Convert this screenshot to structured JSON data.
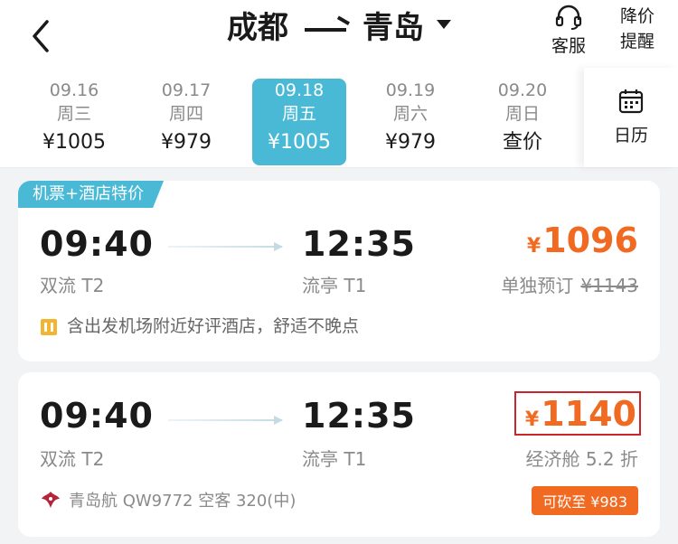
{
  "header": {
    "from": "成都",
    "to": "青岛",
    "customer_service": "客服",
    "price_alert_line1": "降价",
    "price_alert_line2": "提醒"
  },
  "dates": [
    {
      "date": "09.16",
      "weekday": "周三",
      "price": "¥1005"
    },
    {
      "date": "09.17",
      "weekday": "周四",
      "price": "¥979"
    },
    {
      "date": "09.18",
      "weekday": "周五",
      "price": "¥1005"
    },
    {
      "date": "09.19",
      "weekday": "周六",
      "price": "¥979"
    },
    {
      "date": "09.20",
      "weekday": "周日",
      "price": "查价"
    }
  ],
  "calendar": {
    "label": "日历"
  },
  "flights": [
    {
      "badge": "机票+酒店特价",
      "dep_time": "09:40",
      "dep_airport": "双流 T2",
      "arr_time": "12:35",
      "arr_airport": "流亭 T1",
      "currency": "¥",
      "price": "1096",
      "sub_label": "单独预订",
      "original_price": "¥1143",
      "note": "含出发机场附近好评酒店，舒适不晚点"
    },
    {
      "dep_time": "09:40",
      "dep_airport": "双流 T2",
      "arr_time": "12:35",
      "arr_airport": "流亭 T1",
      "currency": "¥",
      "price": "1140",
      "sub_label": "经济舱 5.2 折",
      "airline_info": "青岛航 QW9772  空客 320(中)",
      "discount_tag": "可砍至 ¥983"
    }
  ],
  "colors": {
    "accent": "#49b9d6",
    "price": "#f06a22",
    "highlight_box": "#c8262c"
  }
}
